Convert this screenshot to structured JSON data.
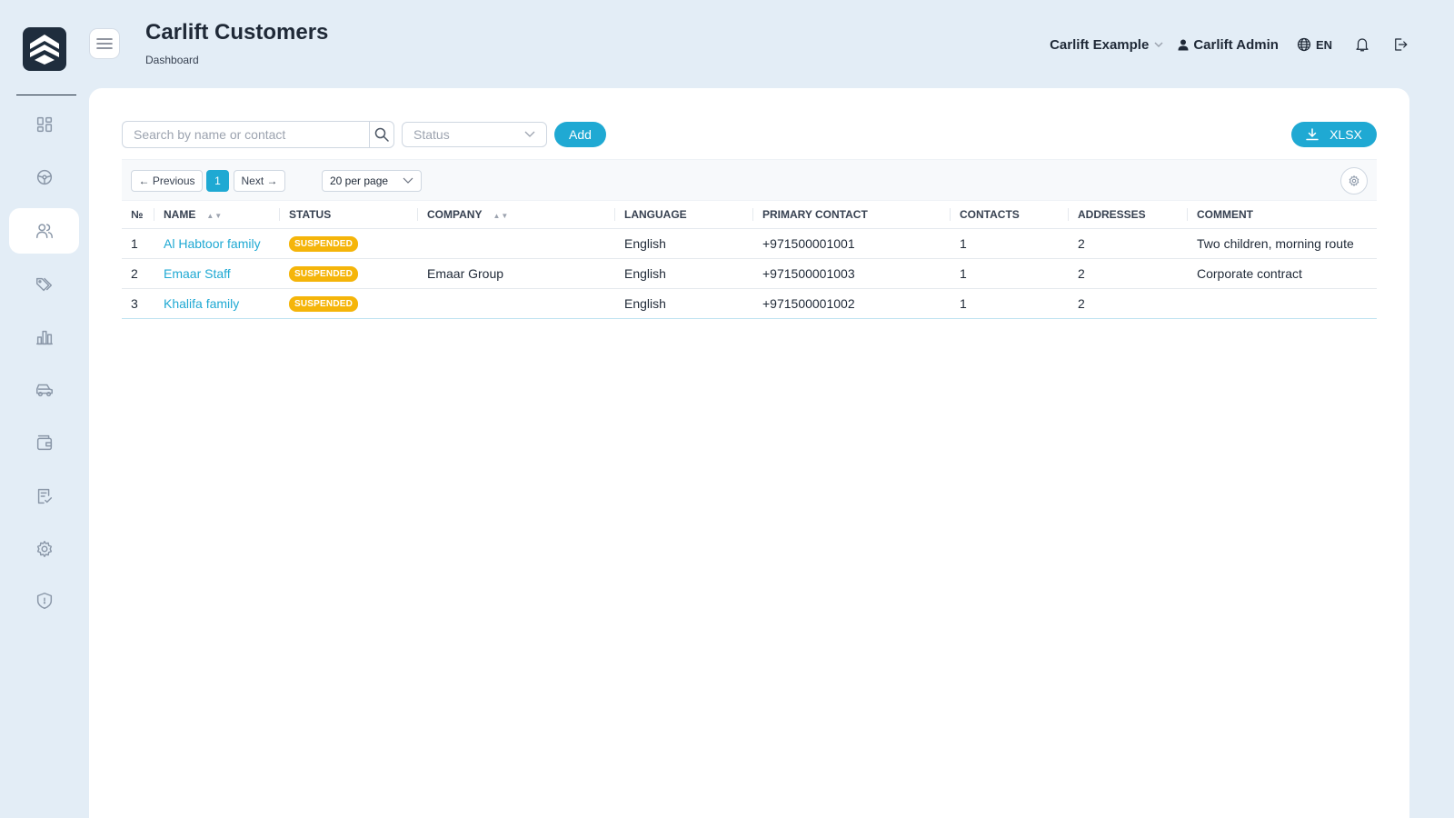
{
  "header": {
    "title": "Carlift Customers",
    "breadcrumb": "Dashboard",
    "company": "Carlift Example",
    "user": "Carlift Admin",
    "language": "EN"
  },
  "sidebar": {
    "items": [
      {
        "name": "dashboard-icon",
        "active": false
      },
      {
        "name": "steering-wheel-icon",
        "active": false
      },
      {
        "name": "users-icon",
        "active": true
      },
      {
        "name": "tags-icon",
        "active": false
      },
      {
        "name": "bar-chart-icon",
        "active": false
      },
      {
        "name": "car-icon",
        "active": false
      },
      {
        "name": "wallet-icon",
        "active": false
      },
      {
        "name": "checklist-icon",
        "active": false
      },
      {
        "name": "gear-icon",
        "active": false
      },
      {
        "name": "shield-icon",
        "active": false
      }
    ]
  },
  "toolbar": {
    "search_placeholder": "Search by name or contact",
    "status_placeholder": "Status",
    "add_label": "Add",
    "xlsx_label": "XLSX"
  },
  "pager": {
    "previous": "← Previous",
    "current": "1",
    "next": "Next →",
    "per_page": "20 per page"
  },
  "table": {
    "columns": [
      "№",
      "NAME",
      "STATUS",
      "COMPANY",
      "LANGUAGE",
      "PRIMARY CONTACT",
      "CONTACTS",
      "ADDRESSES",
      "COMMENT"
    ],
    "rows": [
      {
        "num": "1",
        "name": "Al Habtoor family",
        "status": "SUSPENDED",
        "company": "",
        "language": "English",
        "primary_contact": "+971500001001",
        "contacts": "1",
        "addresses": "2",
        "comment": "Two children, morning route"
      },
      {
        "num": "2",
        "name": "Emaar Staff",
        "status": "SUSPENDED",
        "company": "Emaar Group",
        "language": "English",
        "primary_contact": "+971500001003",
        "contacts": "1",
        "addresses": "2",
        "comment": "Corporate contract"
      },
      {
        "num": "3",
        "name": "Khalifa family",
        "status": "SUSPENDED",
        "company": "",
        "language": "English",
        "primary_contact": "+971500001002",
        "contacts": "1",
        "addresses": "2",
        "comment": ""
      }
    ]
  },
  "colors": {
    "accent": "#1fa9d3",
    "badge": "#f5b50a",
    "background": "#e3edf6"
  }
}
